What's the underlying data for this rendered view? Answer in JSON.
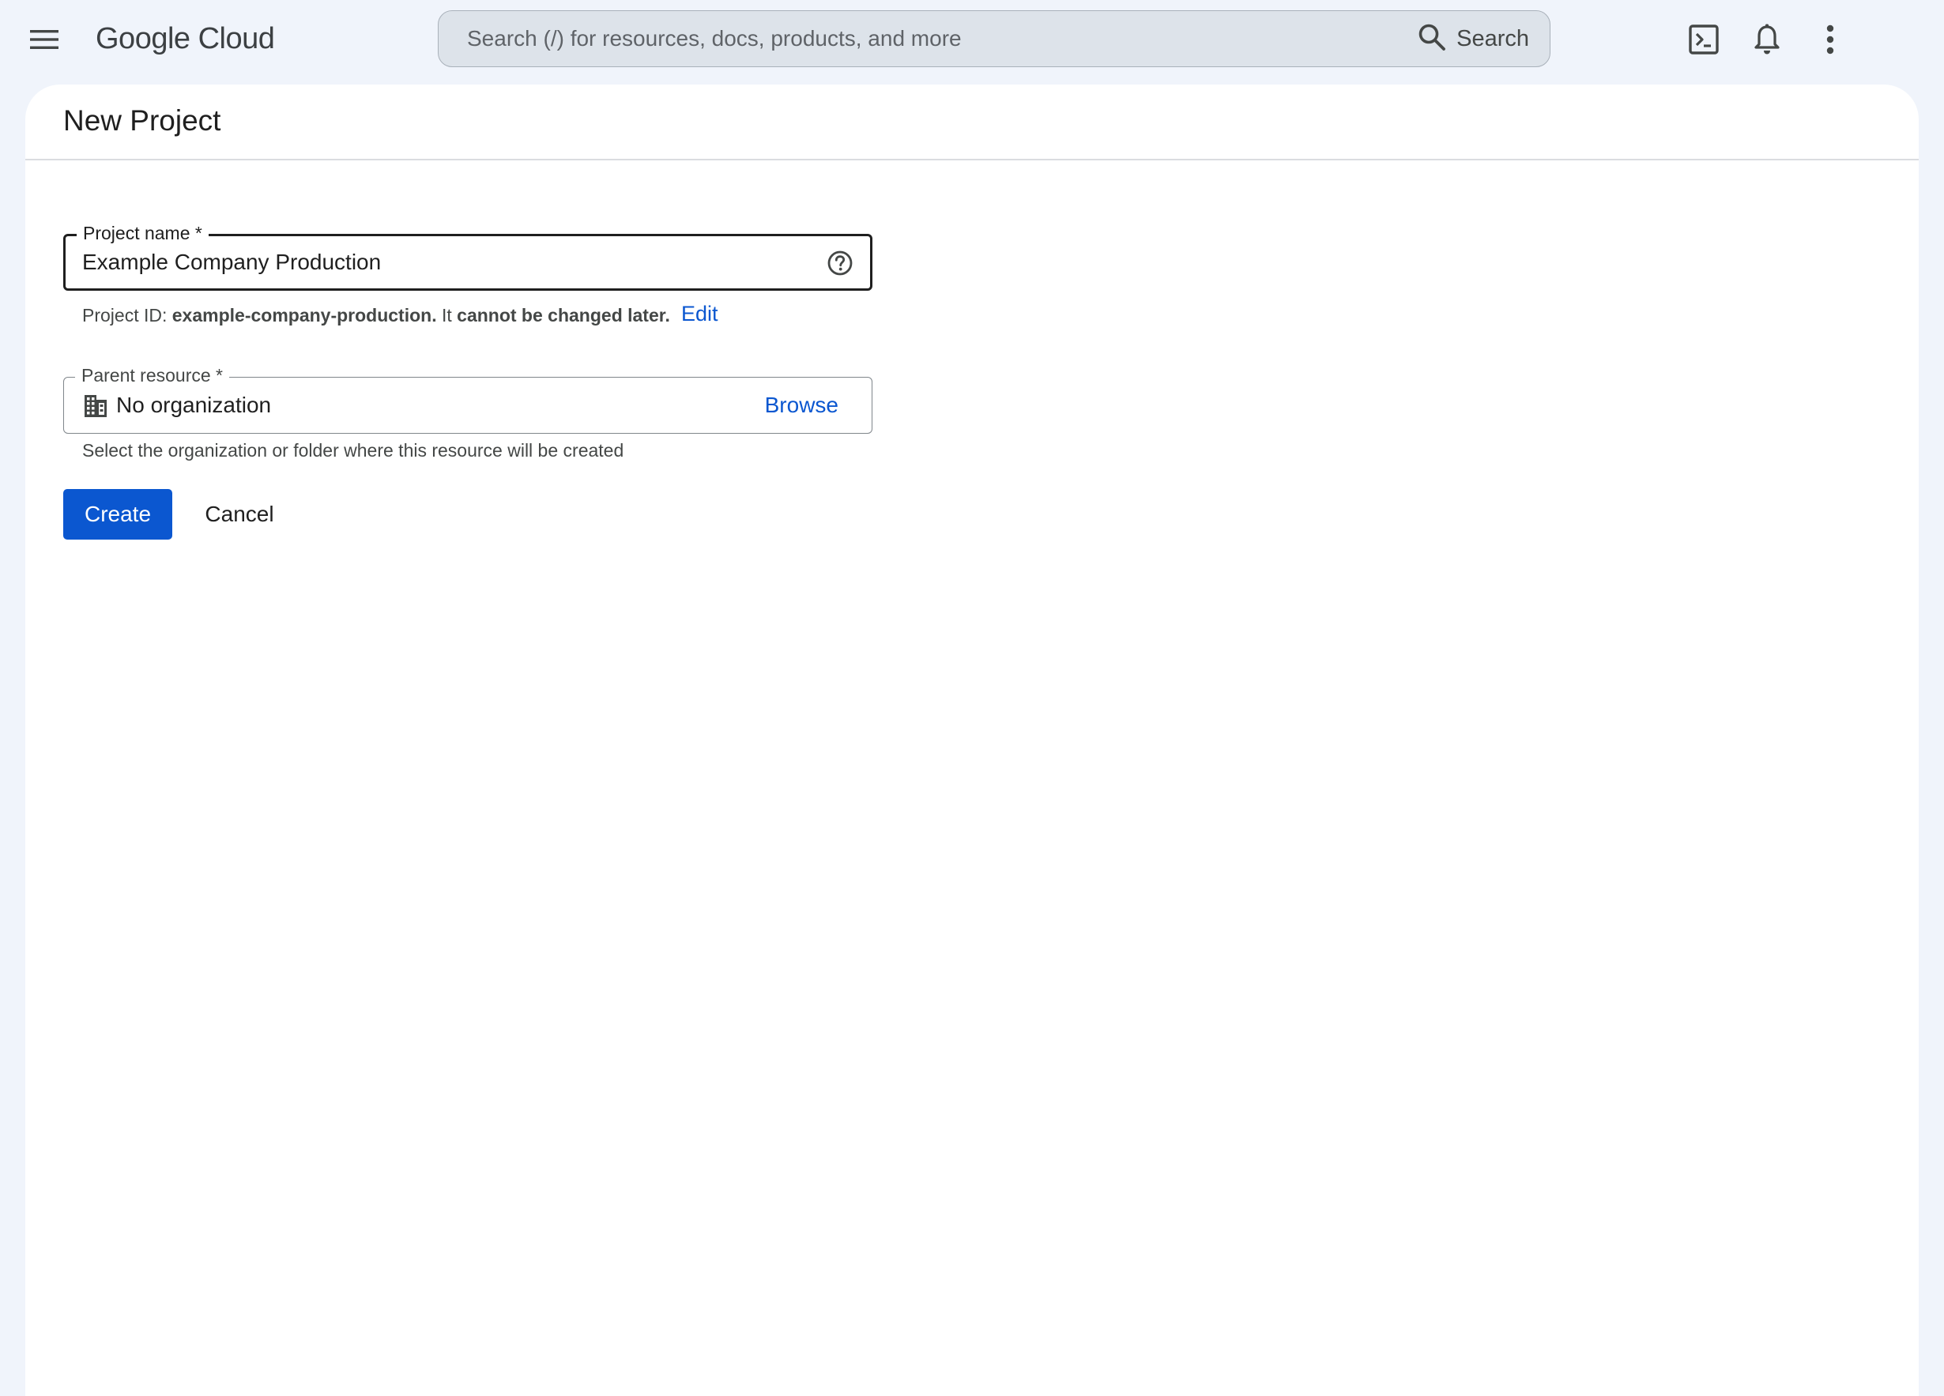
{
  "header": {
    "menu_icon": "hamburger-menu-icon",
    "logo": "Google Cloud",
    "search": {
      "placeholder": "Search (/) for resources, docs, products, and more",
      "value": "",
      "button_label": "Search",
      "icon": "search-icon"
    },
    "icons": [
      "cloud-shell-terminal-icon",
      "notifications-bell-icon",
      "more-vert-icon"
    ]
  },
  "page": {
    "title": "New Project"
  },
  "form": {
    "project_name": {
      "label": "Project name *",
      "value": "Example Company Production",
      "help_icon": "help-circle-icon"
    },
    "project_id": {
      "prefix": "Project ID: ",
      "value": "example-company-production.",
      "middle": " It ",
      "note": "cannot be changed later.",
      "edit_label": "Edit"
    },
    "parent_resource": {
      "label": "Parent resource *",
      "icon": "organization-building-icon",
      "value": "No organization",
      "browse_label": "Browse",
      "hint": "Select the organization or folder where this resource will be created"
    },
    "actions": {
      "create_label": "Create",
      "cancel_label": "Cancel"
    }
  },
  "colors": {
    "page_background": "#f0f4fb",
    "search_background": "#dde3ea",
    "primary": "#0b57d0",
    "text": "#1f1f1f",
    "muted_text": "#444746"
  }
}
